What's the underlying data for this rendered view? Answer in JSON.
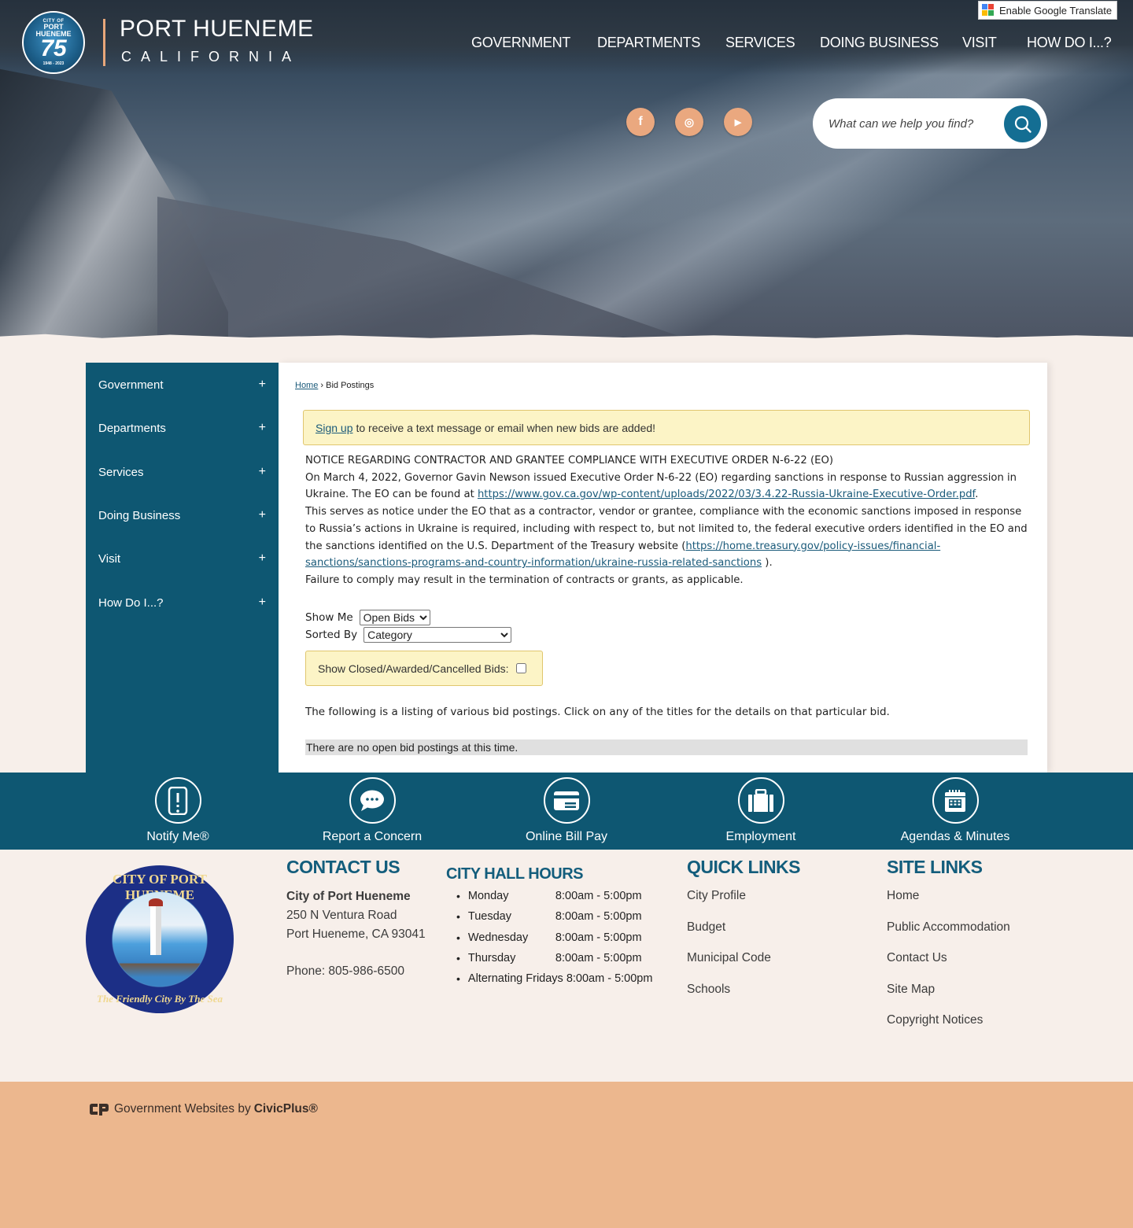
{
  "header": {
    "logo": {
      "line1": "CITY OF",
      "line2": "PORT",
      "line3": "HUENEME",
      "line4": "75",
      "years": "1948 - 2023"
    },
    "brand_name": "PORT HUENEME",
    "brand_sub": "CALIFORNIA",
    "translate_label": "Enable Google Translate",
    "nav": [
      {
        "label": "GOVERNMENT"
      },
      {
        "label": "DEPARTMENTS"
      },
      {
        "label": "SERVICES"
      },
      {
        "label": "DOING BUSINESS"
      },
      {
        "label": "VISIT"
      },
      {
        "label": "HOW DO I...?"
      }
    ],
    "social": [
      {
        "icon": "facebook-icon",
        "glyph": "f"
      },
      {
        "icon": "instagram-icon",
        "glyph": "◎"
      },
      {
        "icon": "youtube-icon",
        "glyph": "▶"
      }
    ],
    "search": {
      "placeholder": "What can we help you find?",
      "value": ""
    }
  },
  "sidebar": {
    "items": [
      {
        "label": "Government",
        "toggle": "+"
      },
      {
        "label": "Departments",
        "toggle": "+"
      },
      {
        "label": "Services",
        "toggle": "+"
      },
      {
        "label": "Doing Business",
        "toggle": "+"
      },
      {
        "label": "Visit",
        "toggle": "+"
      },
      {
        "label": "How Do I...?",
        "toggle": "+"
      }
    ]
  },
  "breadcrumb": {
    "home": "Home",
    "sep": "›",
    "current": "Bid Postings"
  },
  "signup": {
    "link": "Sign up",
    "text": "to receive a text message or email when new bids are added!"
  },
  "notice": {
    "title": "NOTICE REGARDING CONTRACTOR AND GRANTEE COMPLIANCE WITH EXECUTIVE ORDER N-6-22 (EO)",
    "p1": "On March 4, 2022, Governor Gavin Newson issued Executive Order N-6-22 (EO) regarding sanctions in response to Russian aggression in Ukraine. The EO can be found at ",
    "link1": "https://www.gov.ca.gov/wp-content/uploads/2022/03/3.4.22-Russia-Ukraine-Executive-Order.pdf",
    "p1_end": ".",
    "p2": "This serves as notice under the EO that as a contractor, vendor or grantee, compliance with the economic sanctions imposed in response to Russia’s actions in Ukraine is required, including with respect to, but not limited to, the federal executive orders identified in the EO and the sanctions identified on the U.S. Department of the Treasury website (",
    "link2": "https://home.treasury.gov/policy-issues/financial-sanctions/sanctions-programs-and-country-information/ukraine-russia-related-sanctions",
    "p2_end": " ).",
    "p3": "Failure to comply may result in the termination of contracts or grants, as applicable."
  },
  "filters": {
    "show_me_label": "Show Me",
    "show_me_value": "Open Bids",
    "sorted_by_label": "Sorted By",
    "sorted_by_value": "Category",
    "closed_label": "Show Closed/Awarded/Cancelled Bids:",
    "closed_checked": false
  },
  "listing": {
    "intro": "The following is a listing of various bid postings. Click on any of the titles for the details on that particular bid.",
    "empty": "There are no open bid postings at this time."
  },
  "quickbar": [
    {
      "label": "Notify Me®",
      "icon": "phone-alert-icon"
    },
    {
      "label": "Report a Concern",
      "icon": "chat-bubble-icon"
    },
    {
      "label": "Online Bill Pay",
      "icon": "credit-card-icon"
    },
    {
      "label": "Employment",
      "icon": "briefcase-icon"
    },
    {
      "label": "Agendas & Minutes",
      "icon": "calendar-icon"
    }
  ],
  "footer": {
    "seal": {
      "top": "CITY OF PORT HUENEME",
      "bottom": "The Friendly City By The Sea"
    },
    "contact": {
      "heading": "CONTACT US",
      "org": "City of Port Hueneme",
      "address1": "250 N Ventura Road",
      "address2": "Port Hueneme, CA 93041",
      "phone": "Phone: 805-986-6500"
    },
    "hours": {
      "heading": "CITY HALL HOURS",
      "rows": [
        {
          "day": "Monday",
          "time": "8:00am - 5:00pm"
        },
        {
          "day": "Tuesday",
          "time": "8:00am - 5:00pm"
        },
        {
          "day": "Wednesday",
          "time": "8:00am - 5:00pm"
        },
        {
          "day": "Thursday",
          "time": "8:00am - 5:00pm"
        },
        {
          "day": "Alternating Fridays",
          "time": "8:00am - 5:00pm"
        }
      ]
    },
    "quick_links": {
      "heading": "QUICK LINKS",
      "items": [
        "City Profile",
        "Budget",
        "Municipal Code",
        "Schools"
      ]
    },
    "site_links": {
      "heading": "SITE LINKS",
      "items": [
        "Home",
        "Public Accommodation",
        "Contact Us",
        "Site Map",
        "Copyright Notices"
      ]
    },
    "civicplus": {
      "prefix": "Government Websites by",
      "brand": "CivicPlus®"
    }
  },
  "colors": {
    "primary": "#0e5772",
    "accent": "#eaa87f",
    "footer_bottom": "#ecb78e",
    "page_bg": "#f7efea",
    "notice_bg": "#fcf4c6"
  }
}
